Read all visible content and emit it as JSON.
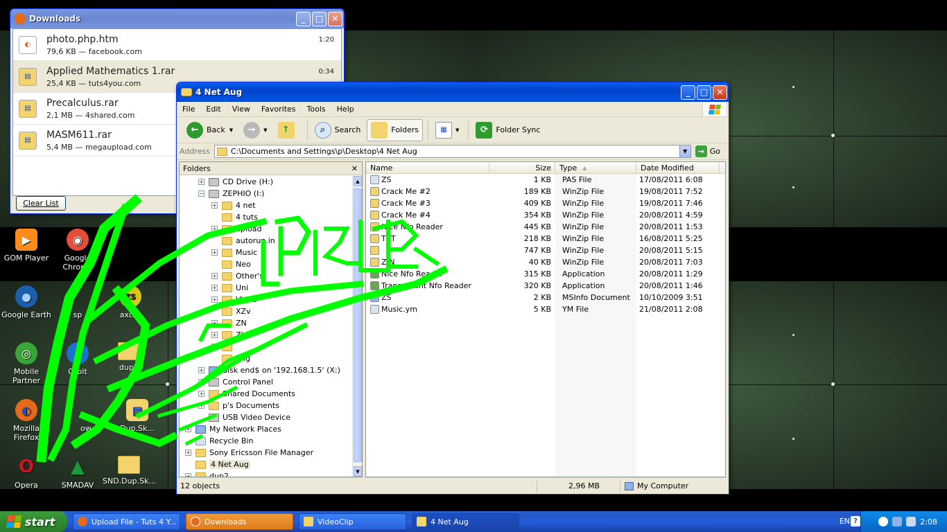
{
  "colors": {
    "xp_blue": "#0054e3",
    "scribble_green": "#00ff00",
    "taskbar_active": "#e07b1a"
  },
  "desktop": {
    "icons": [
      {
        "label": "GOM Player",
        "icon": "gom-player-icon",
        "color": "#ff8c1a",
        "glyph": "▶"
      },
      {
        "label": "Google Chrome",
        "icon": "chrome-icon",
        "color": "#e44d3a",
        "glyph": "◉"
      },
      {
        "label": "Google Earth",
        "icon": "earth-icon",
        "color": "#1c5fae",
        "glyph": "●"
      },
      {
        "label": "Mobile Partner",
        "icon": "mobile-partner-icon",
        "color": "#3aa63a",
        "glyph": "◎"
      },
      {
        "label": "Orbit",
        "icon": "orbit-icon",
        "color": "#1d6fd0",
        "glyph": "↓"
      },
      {
        "label": "dup2",
        "icon": "folder-icon",
        "color": "#f3d36c",
        "glyph": ""
      },
      {
        "label": "Mozilla Firefox",
        "icon": "firefox-icon",
        "color": "#e66a1a",
        "glyph": "◐"
      },
      {
        "label": "ow",
        "icon": "shortcut-icon",
        "color": "#3b3b3b",
        "glyph": ""
      },
      {
        "label": "Dup.Sk...",
        "icon": "rar-file-icon",
        "color": "#f3d36c",
        "glyph": "▤"
      },
      {
        "label": "Opera",
        "icon": "opera-icon",
        "color": "#d0121a",
        "glyph": "O"
      },
      {
        "label": "SMADAV",
        "icon": "smadav-icon",
        "color": "#1a9a3a",
        "glyph": "▲"
      },
      {
        "label": "SND.Dup.Sk...",
        "icon": "folder-icon",
        "color": "#f3d36c",
        "glyph": ""
      },
      {
        "label": "axcur",
        "icon": "zs-icon",
        "color": "#d6c51a",
        "glyph": "ZS"
      },
      {
        "label": "sp",
        "icon": "shortcut-icon",
        "color": "#3b3b3b",
        "glyph": ""
      }
    ]
  },
  "downloads": {
    "title": "Downloads",
    "clear_label": "Clear List",
    "items": [
      {
        "name": "photo.php.htm",
        "meta": "79,6 KB — facebook.com",
        "time": "1:20",
        "icon": "firefox-file-icon",
        "color": "#e66a1a"
      },
      {
        "name": "Applied Mathematics 1.rar",
        "meta": "25,4 KB — tuts4you.com",
        "time": "0:34",
        "icon": "rar-file-icon",
        "color": "#f3d36c"
      },
      {
        "name": "Precalculus.rar",
        "meta": "2,1 MB — 4shared.com",
        "time": "",
        "icon": "rar-file-icon",
        "color": "#f3d36c"
      },
      {
        "name": "MASM611.rar",
        "meta": "5,4 MB — megaupload.com",
        "time": "",
        "icon": "rar-file-icon",
        "color": "#f3d36c"
      }
    ]
  },
  "explorer": {
    "title": "4 Net Aug",
    "menu": [
      "File",
      "Edit",
      "View",
      "Favorites",
      "Tools",
      "Help"
    ],
    "toolbar": {
      "back": "Back",
      "search": "Search",
      "folders": "Folders",
      "folder_sync": "Folder Sync"
    },
    "address": {
      "label": "Address",
      "value": "C:\\Documents and Settings\\p\\Desktop\\4 Net Aug",
      "go": "Go"
    },
    "folders_panel": {
      "title": "Folders",
      "close": "✕",
      "tree": [
        {
          "label": "CD Drive (H:)",
          "indent": 1,
          "exp": "+",
          "kind": "drive"
        },
        {
          "label": "ZEPHIO (I:)",
          "indent": 1,
          "exp": "-",
          "kind": "drive"
        },
        {
          "label": "4 net",
          "indent": 2,
          "exp": "+",
          "kind": "folder"
        },
        {
          "label": "4 tuts",
          "indent": 2,
          "exp": "",
          "kind": "folder"
        },
        {
          "label": "upload",
          "indent": 2,
          "exp": "+",
          "kind": "folder"
        },
        {
          "label": "autorun.in",
          "indent": 2,
          "exp": "",
          "kind": "folder"
        },
        {
          "label": "Music",
          "indent": 2,
          "exp": "+",
          "kind": "folder"
        },
        {
          "label": "Neo",
          "indent": 2,
          "exp": "",
          "kind": "folder"
        },
        {
          "label": "Other's",
          "indent": 2,
          "exp": "+",
          "kind": "folder"
        },
        {
          "label": "Uni",
          "indent": 2,
          "exp": "+",
          "kind": "folder"
        },
        {
          "label": "Video",
          "indent": 2,
          "exp": "+",
          "kind": "folder"
        },
        {
          "label": "XZv",
          "indent": 2,
          "exp": "",
          "kind": "folder"
        },
        {
          "label": "ZN",
          "indent": 2,
          "exp": "+",
          "kind": "folder"
        },
        {
          "label": "ZI",
          "indent": 2,
          "exp": "+",
          "kind": "folder"
        },
        {
          "label": "",
          "indent": 2,
          "exp": "+",
          "kind": "folder"
        },
        {
          "label": "nhg",
          "indent": 2,
          "exp": "",
          "kind": "folder"
        },
        {
          "label": "disk end$ on '192.168.1.5' (X:)",
          "indent": 1,
          "exp": "+",
          "kind": "net"
        },
        {
          "label": "Control Panel",
          "indent": 1,
          "exp": "+",
          "kind": "drive"
        },
        {
          "label": "Shared Documents",
          "indent": 1,
          "exp": "+",
          "kind": "folder"
        },
        {
          "label": "p's Documents",
          "indent": 1,
          "exp": "+",
          "kind": "folder"
        },
        {
          "label": "USB Video Device",
          "indent": 1,
          "exp": "",
          "kind": "drive"
        },
        {
          "label": "My Network Places",
          "indent": 0,
          "exp": "+",
          "kind": "net"
        },
        {
          "label": "Recycle Bin",
          "indent": 0,
          "exp": "",
          "kind": "bin"
        },
        {
          "label": "Sony Ericsson File Manager",
          "indent": 0,
          "exp": "+",
          "kind": "folder"
        },
        {
          "label": "4 Net Aug",
          "indent": 0,
          "exp": "",
          "kind": "folder",
          "selected": true
        },
        {
          "label": "dup2",
          "indent": 0,
          "exp": "+",
          "kind": "folder"
        }
      ]
    },
    "columns": {
      "name": "Name",
      "size": "Size",
      "type": "Type",
      "date": "Date Modified"
    },
    "files": [
      {
        "name": "ZS",
        "size": "1 KB",
        "type": "PAS File",
        "date": "17/08/2011 6:08",
        "icon": "pas-file-icon",
        "color": "#d8e3f0"
      },
      {
        "name": "Crack Me #2",
        "size": "189 KB",
        "type": "WinZip File",
        "date": "19/08/2011 7:52",
        "icon": "winzip-file-icon",
        "color": "#f3d36c"
      },
      {
        "name": "Crack Me #3",
        "size": "409 KB",
        "type": "WinZip File",
        "date": "19/08/2011 7:46",
        "icon": "winzip-file-icon",
        "color": "#f3d36c"
      },
      {
        "name": "Crack Me #4",
        "size": "354 KB",
        "type": "WinZip File",
        "date": "20/08/2011 4:59",
        "icon": "winzip-file-icon",
        "color": "#f3d36c"
      },
      {
        "name": "Nice Nfo Reader",
        "size": "445 KB",
        "type": "WinZip File",
        "date": "20/08/2011 1:53",
        "icon": "winzip-file-icon",
        "color": "#f3d36c"
      },
      {
        "name": "TXT",
        "size": "218 KB",
        "type": "WinZip File",
        "date": "16/08/2011 5:25",
        "icon": "winzip-file-icon",
        "color": "#f3d36c"
      },
      {
        "name": "",
        "size": "747 KB",
        "type": "WinZip File",
        "date": "20/08/2011 5:15",
        "icon": "winzip-file-icon",
        "color": "#f3d36c"
      },
      {
        "name": "Z-N",
        "size": "40 KB",
        "type": "WinZip File",
        "date": "20/08/2011 7:03",
        "icon": "winzip-file-icon",
        "color": "#f3d36c"
      },
      {
        "name": "Nice Nfo Reader",
        "size": "315 KB",
        "type": "Application",
        "date": "20/08/2011 1:29",
        "icon": "app-icon",
        "color": "#6aa84f"
      },
      {
        "name": "Transparent Nfo Reader",
        "size": "320 KB",
        "type": "Application",
        "date": "20/08/2011 1:46",
        "icon": "app-icon",
        "color": "#6aa84f"
      },
      {
        "name": "ZS",
        "size": "2 KB",
        "type": "MSInfo Document",
        "date": "10/10/2009 3:51",
        "icon": "msinfo-icon",
        "color": "#8fb3e8"
      },
      {
        "name": "Music.ym",
        "size": "5 KB",
        "type": "YM File",
        "date": "21/08/2011 2:08",
        "icon": "ym-file-icon",
        "color": "#d8e3f0"
      }
    ],
    "status": {
      "objects": "12 objects",
      "size": "2,96 MB",
      "location": "My Computer"
    }
  },
  "taskbar": {
    "start": "start",
    "tasks": [
      {
        "label": "Upload File - Tuts 4 Y...",
        "icon": "firefox-icon",
        "color": "#e66a1a",
        "active": false
      },
      {
        "label": "Downloads",
        "icon": "firefox-icon",
        "color": "#e66a1a",
        "active": true
      },
      {
        "label": "VideoClip",
        "icon": "folder-icon",
        "color": "#f3d36c",
        "active": false
      },
      {
        "label": "4 Net Aug",
        "icon": "folder-icon",
        "color": "#f3d36c",
        "active": false
      }
    ],
    "lang": "EN",
    "help": "?",
    "clock": "2:08"
  }
}
